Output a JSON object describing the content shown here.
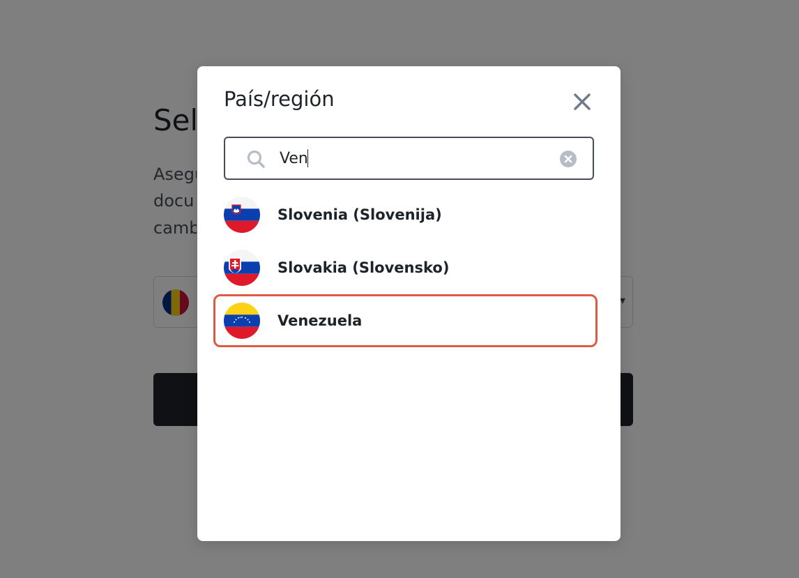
{
  "background": {
    "title_fragment": "Sel",
    "text_lines": [
      "Asegu",
      "docu",
      "camb"
    ]
  },
  "modal": {
    "title": "País/región",
    "search": {
      "value": "Ven",
      "placeholder": ""
    },
    "results": [
      {
        "label": "Slovenia (Slovenija)",
        "flag": "slovenia-flag",
        "selected": false
      },
      {
        "label": "Slovakia (Slovensko)",
        "flag": "slovakia-flag",
        "selected": false
      },
      {
        "label": "Venezuela",
        "flag": "venezuela-flag",
        "selected": true
      }
    ]
  },
  "colors": {
    "highlight_border": "#dd5a45",
    "overlay": "rgba(0,0,0,0.5)",
    "text_primary": "#1e2329"
  }
}
